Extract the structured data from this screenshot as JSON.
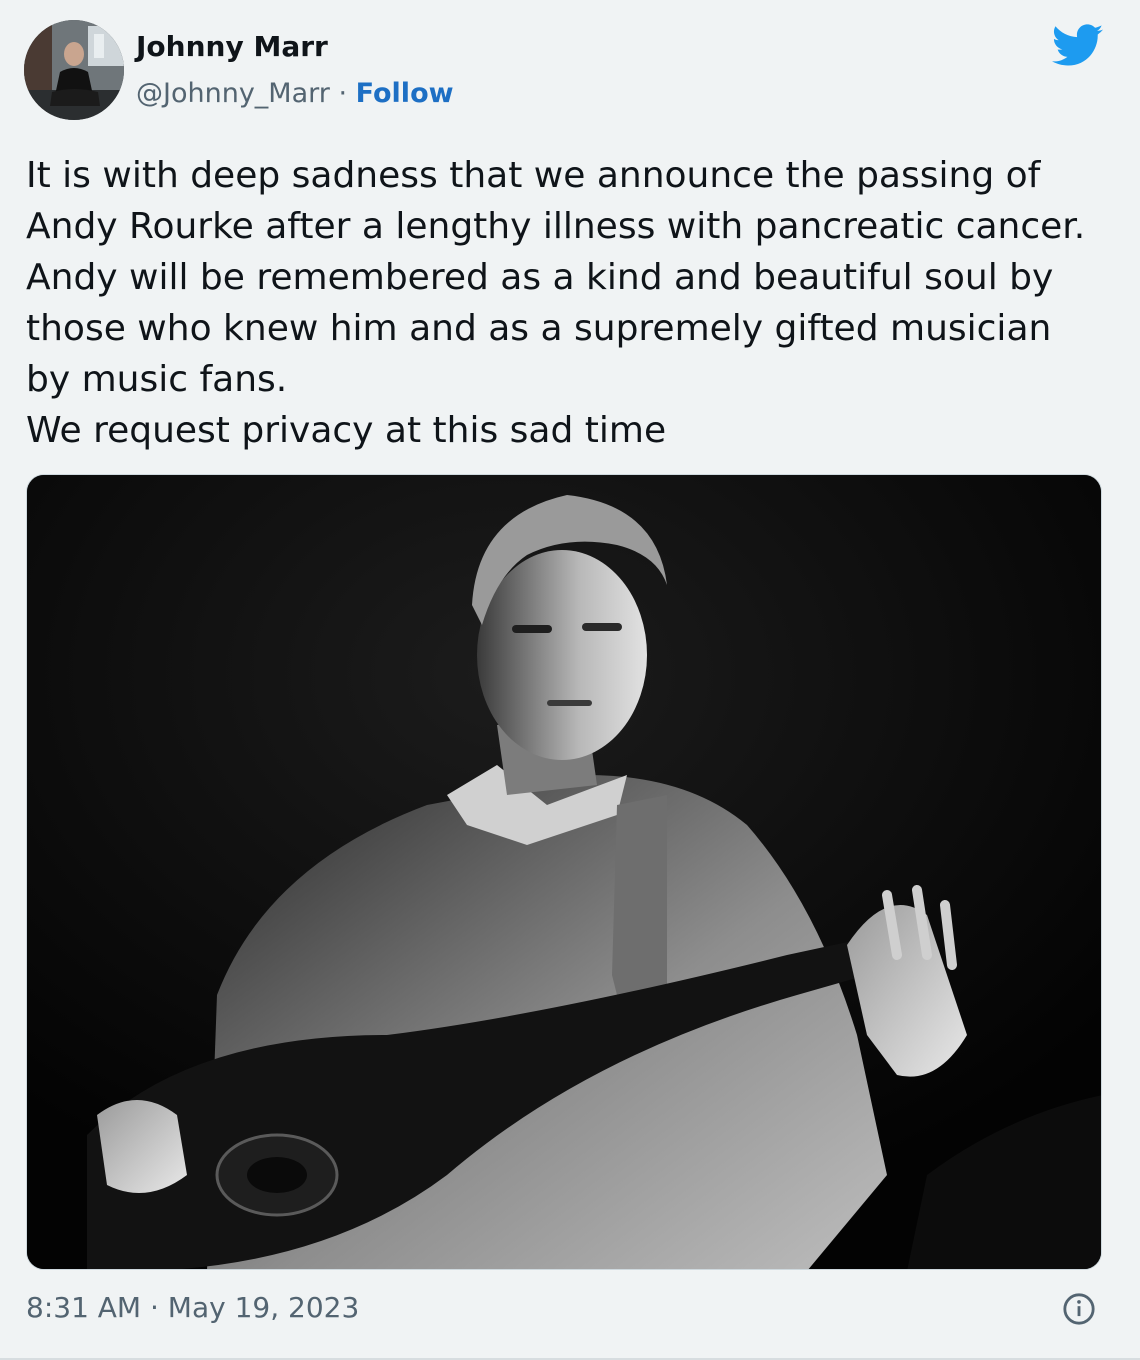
{
  "tweet": {
    "author": {
      "display_name": "Johnny Marr",
      "handle": "@Johnny_Marr",
      "separator": "·",
      "follow_label": "Follow"
    },
    "brand_color": "#1d9bf0",
    "text_lines": [
      "It is with deep sadness that we announce the passing of",
      "Andy Rourke after a lengthy illness with pancreatic cancer.",
      "Andy will be remembered as a kind and beautiful soul by",
      "those who knew him and as a supremely gifted musician",
      "by music fans.",
      "We request privacy at this sad time"
    ],
    "photo": {
      "style": "black-and-white"
    },
    "timestamp": "8:31 AM · May 19, 2023",
    "icons": {
      "brand": "twitter-bird-icon",
      "info": "info-icon"
    }
  }
}
